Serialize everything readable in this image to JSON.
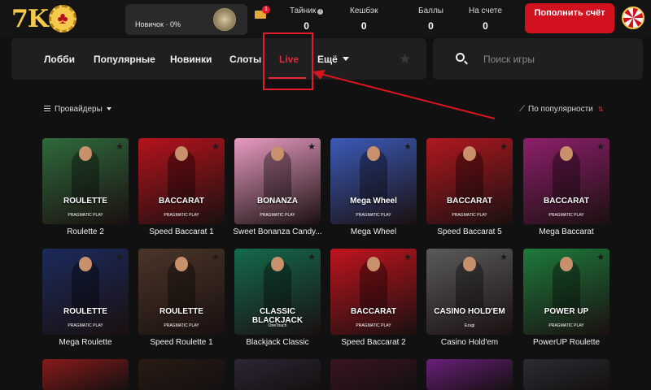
{
  "header": {
    "logo_text": "7K",
    "rank_label": "Новичок · 0%",
    "mail_count": "1",
    "stats": [
      {
        "label": "Тайник",
        "value": "0",
        "has_info": true
      },
      {
        "label": "Кешбэк",
        "value": "0"
      },
      {
        "label": "Баллы",
        "value": "0"
      },
      {
        "label": "На счете",
        "value": "0"
      }
    ],
    "deposit_label": "Пополнить счёт"
  },
  "nav": {
    "items": [
      "Лобби",
      "Популярные",
      "Новинки",
      "Слоты",
      "Live"
    ],
    "more_label": "Ещё",
    "active": "Live"
  },
  "search": {
    "placeholder": "Поиск игры"
  },
  "filters": {
    "providers_label": "Провайдеры",
    "sort_label": "По популярности"
  },
  "games": [
    {
      "title": "Roulette 2",
      "overlay": "ROULETTE",
      "provider": "PRAGMATIC PLAY",
      "color": "#2f6a3c"
    },
    {
      "title": "Speed Baccarat 1",
      "overlay": "BACCARAT",
      "provider": "PRAGMATIC PLAY",
      "color": "#b5131c"
    },
    {
      "title": "Sweet Bonanza Candy...",
      "overlay": "BONANZA",
      "provider": "PRAGMATIC PLAY",
      "color": "#e89bc3"
    },
    {
      "title": "Mega Wheel",
      "overlay": "Mega Wheel",
      "provider": "PRAGMATIC PLAY",
      "color": "#3b5ab8"
    },
    {
      "title": "Speed Baccarat 5",
      "overlay": "BACCARAT",
      "provider": "PRAGMATIC PLAY",
      "color": "#b01820"
    },
    {
      "title": "Mega Baccarat",
      "overlay": "BACCARAT",
      "provider": "PRAGMATIC PLAY",
      "color": "#8e1f6b"
    },
    {
      "title": "Mega Roulette",
      "overlay": "ROULETTE",
      "provider": "PRAGMATIC PLAY",
      "color": "#1b2a5c"
    },
    {
      "title": "Speed Roulette 1",
      "overlay": "ROULETTE",
      "provider": "PRAGMATIC PLAY",
      "color": "#4a3528"
    },
    {
      "title": "Blackjack Classic",
      "overlay": "CLASSIC BLACKJACK",
      "provider": "OneTouch",
      "color": "#146a4c"
    },
    {
      "title": "Speed Baccarat 2",
      "overlay": "BACCARAT",
      "provider": "PRAGMATIC PLAY",
      "color": "#c0141e"
    },
    {
      "title": "Casino Hold'em",
      "overlay": "CASINO HOLD'EM",
      "provider": "Ezugi",
      "color": "#5a5a5a"
    },
    {
      "title": "PowerUP Roulette",
      "overlay": "POWER UP",
      "provider": "PRAGMATIC PLAY",
      "color": "#1d7a3c"
    }
  ],
  "partial_row_colors": [
    "#8a1a1a",
    "#2a1a14",
    "#2c2636",
    "#3a1420",
    "#6a1f7a",
    "#2c2c34"
  ]
}
